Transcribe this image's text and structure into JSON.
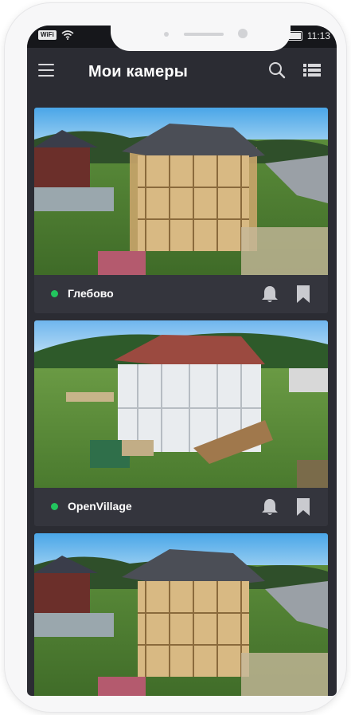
{
  "status_bar": {
    "wifi_label": "WiFi",
    "battery_text": "%",
    "time": "11:13"
  },
  "app_bar": {
    "title": "Мои камеры",
    "icons": [
      "menu-icon",
      "search-icon",
      "list-view-icon"
    ]
  },
  "cameras": [
    {
      "name": "Глебово",
      "status": "online",
      "status_color": "#22c55e"
    },
    {
      "name": "OpenVillage",
      "status": "online",
      "status_color": "#22c55e"
    },
    {
      "name": "",
      "status": "online",
      "status_color": "#22c55e"
    }
  ],
  "colors": {
    "background": "#2b2c33",
    "card": "#34353d",
    "online": "#22c55e"
  }
}
